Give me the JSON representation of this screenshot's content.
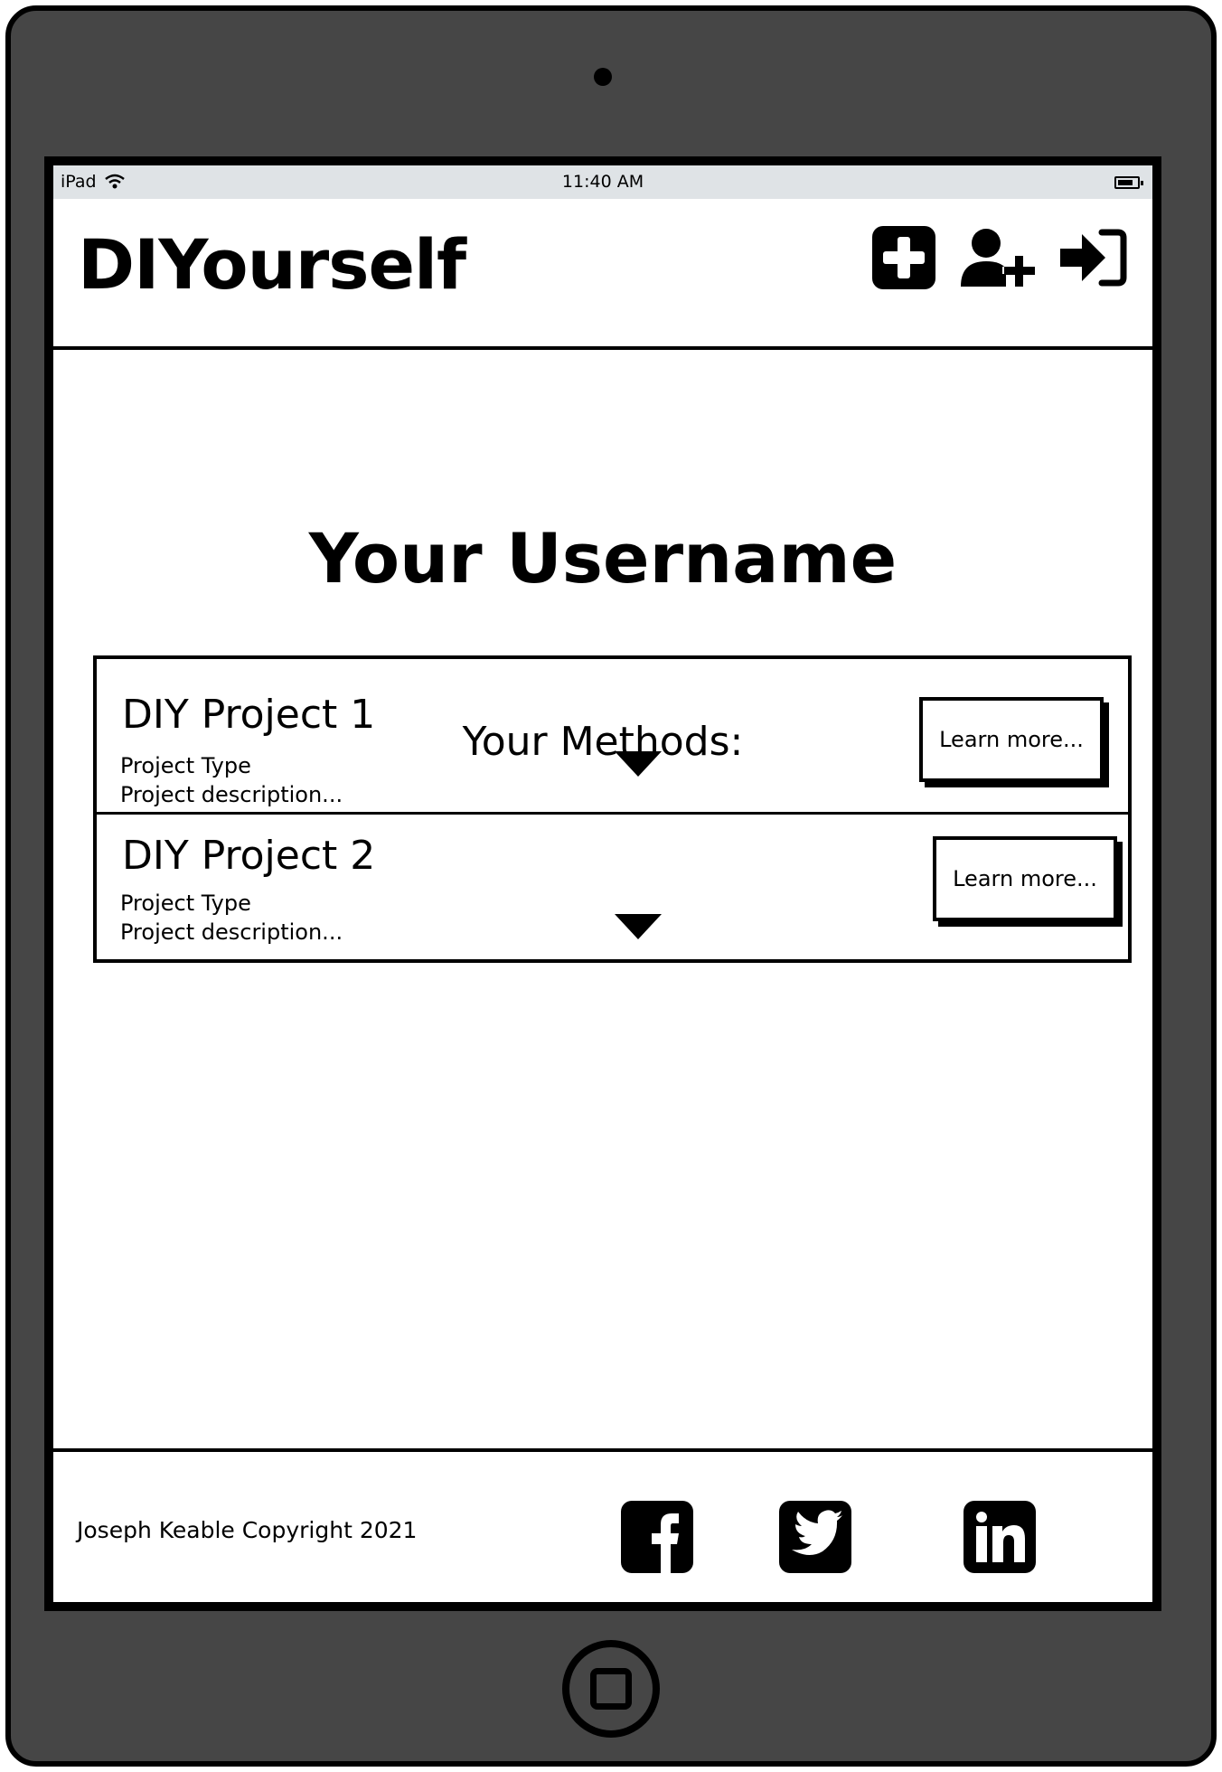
{
  "status_bar": {
    "device": "iPad",
    "time": "11:40 AM"
  },
  "header": {
    "brand": "DIYourself",
    "icons": [
      "add-square-icon",
      "add-user-icon",
      "sign-in-icon"
    ]
  },
  "profile": {
    "username": "Your Username",
    "methods_heading": "Your Methods:"
  },
  "methods": [
    {
      "title": "DIY Project 1",
      "type": "Project Type",
      "description": "Project description...",
      "button_label": "Learn more..."
    },
    {
      "title": "DIY Project 2",
      "type": "Project Type",
      "description": "Project description...",
      "button_label": "Learn more..."
    }
  ],
  "footer": {
    "copyright": "Joseph Keable Copyright 2021",
    "social": [
      "facebook-icon",
      "twitter-icon",
      "linkedin-icon"
    ]
  },
  "colors": {
    "device_body": "#464646",
    "status_bar": "#dfe3e6",
    "ink": "#000000",
    "paper": "#ffffff"
  }
}
